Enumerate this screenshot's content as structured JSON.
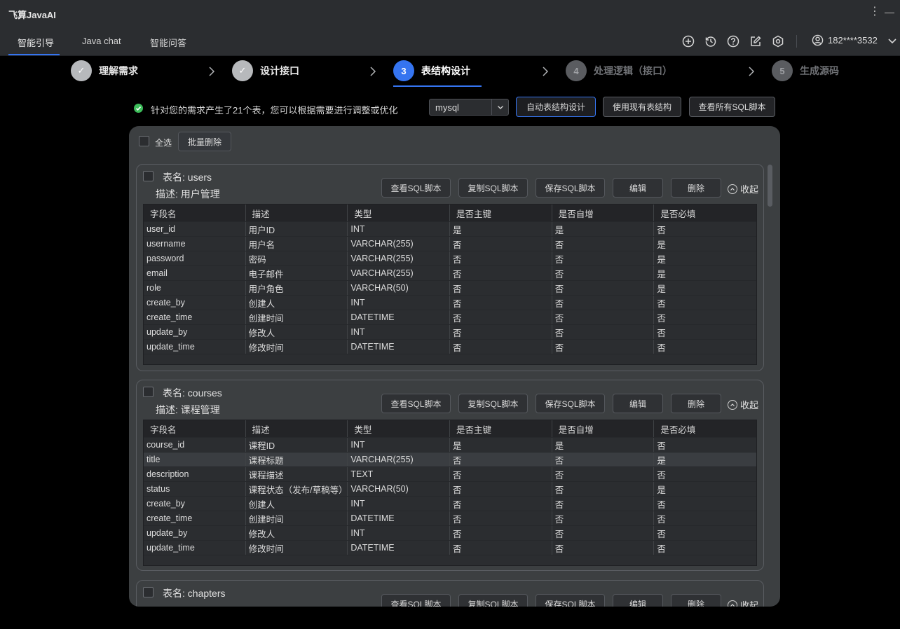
{
  "app": {
    "title": "飞算JavaAI"
  },
  "tabs": [
    {
      "label": "智能引导",
      "active": true
    },
    {
      "label": "Java chat",
      "active": false
    },
    {
      "label": "智能问答",
      "active": false
    }
  ],
  "toolbar_icons": [
    "plus-circle-icon",
    "history-icon",
    "help-icon",
    "edit-icon",
    "settings-icon"
  ],
  "user": {
    "name": "182****3532"
  },
  "steps": [
    {
      "num": "✓",
      "label": "理解需求",
      "state": "done"
    },
    {
      "num": "✓",
      "label": "设计接口",
      "state": "done"
    },
    {
      "num": "3",
      "label": "表结构设计",
      "state": "current"
    },
    {
      "num": "4",
      "label": "处理逻辑（接口）",
      "state": "todo"
    },
    {
      "num": "5",
      "label": "生成源码",
      "state": "todo"
    }
  ],
  "info": {
    "message": "针对您的需求产生了21个表，您可以根据需要进行调整或优化",
    "db_select": "mysql",
    "buttons": {
      "auto": "自动表结构设计",
      "use_existing": "使用现有表结构",
      "view_all": "查看所有SQL脚本"
    }
  },
  "panel": {
    "select_all": "全选",
    "batch_delete": "批量删除",
    "columns": [
      "字段名",
      "描述",
      "类型",
      "是否主键",
      "是否自增",
      "是否必填"
    ],
    "card_buttons": {
      "view": "查看SQL脚本",
      "copy": "复制SQL脚本",
      "save": "保存SQL脚本",
      "edit": "编辑",
      "delete": "删除",
      "collapse": "收起"
    },
    "tables": [
      {
        "name": "表名: users",
        "desc": "描述: 用户管理",
        "rows": [
          [
            "user_id",
            "用户ID",
            "INT",
            "是",
            "是",
            "否"
          ],
          [
            "username",
            "用户名",
            "VARCHAR(255)",
            "否",
            "否",
            "是"
          ],
          [
            "password",
            "密码",
            "VARCHAR(255)",
            "否",
            "否",
            "是"
          ],
          [
            "email",
            "电子邮件",
            "VARCHAR(255)",
            "否",
            "否",
            "是"
          ],
          [
            "role",
            "用户角色",
            "VARCHAR(50)",
            "否",
            "否",
            "是"
          ],
          [
            "create_by",
            "创建人",
            "INT",
            "否",
            "否",
            "否"
          ],
          [
            "create_time",
            "创建时间",
            "DATETIME",
            "否",
            "否",
            "否"
          ],
          [
            "update_by",
            "修改人",
            "INT",
            "否",
            "否",
            "否"
          ],
          [
            "update_time",
            "修改时间",
            "DATETIME",
            "否",
            "否",
            "否"
          ]
        ]
      },
      {
        "name": "表名: courses",
        "desc": "描述: 课程管理",
        "highlight_row": 1,
        "rows": [
          [
            "course_id",
            "课程ID",
            "INT",
            "是",
            "是",
            "否"
          ],
          [
            "title",
            "课程标题",
            "VARCHAR(255)",
            "否",
            "否",
            "是"
          ],
          [
            "description",
            "课程描述",
            "TEXT",
            "否",
            "否",
            "否"
          ],
          [
            "status",
            "课程状态（发布/草稿等）",
            "VARCHAR(50)",
            "否",
            "否",
            "是"
          ],
          [
            "create_by",
            "创建人",
            "INT",
            "否",
            "否",
            "否"
          ],
          [
            "create_time",
            "创建时间",
            "DATETIME",
            "否",
            "否",
            "否"
          ],
          [
            "update_by",
            "修改人",
            "INT",
            "否",
            "否",
            "否"
          ],
          [
            "update_time",
            "修改时间",
            "DATETIME",
            "否",
            "否",
            "否"
          ]
        ]
      },
      {
        "name": "表名: chapters",
        "desc": "",
        "rows": []
      }
    ]
  },
  "colors": {
    "accent": "#3574f0",
    "success": "#3dbd5b",
    "panel_bg": "#3c3f41",
    "grid_bg": "#2b2d30"
  }
}
